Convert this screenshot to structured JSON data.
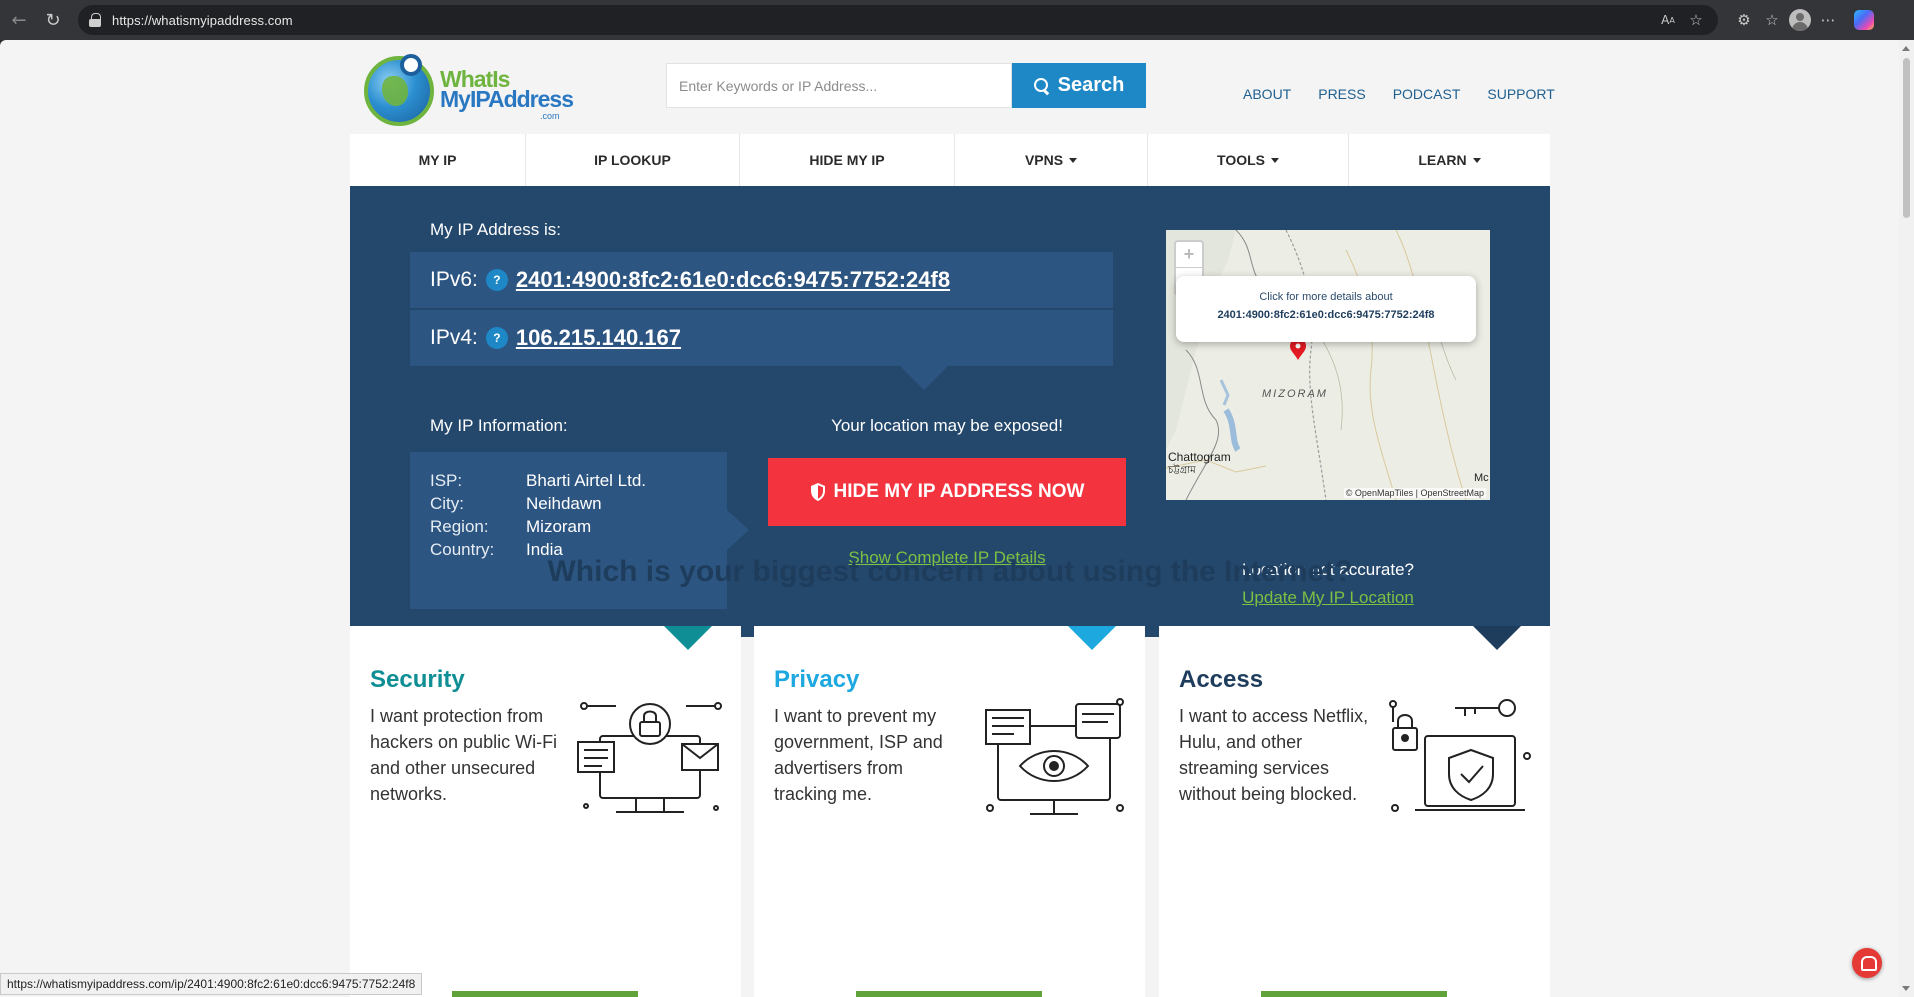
{
  "browser": {
    "url": "https://whatismyipaddress.com",
    "status_url": "https://whatismyipaddress.com/ip/2401:4900:8fc2:61e0:dcc6:9475:7752:24f8"
  },
  "logo": {
    "line1": "WhatIs",
    "line2": "MyIPAddress",
    "line3": ".com"
  },
  "search": {
    "placeholder": "Enter Keywords or IP Address...",
    "button": "Search"
  },
  "toplinks": [
    "ABOUT",
    "PRESS",
    "PODCAST",
    "SUPPORT"
  ],
  "nav": [
    {
      "label": "MY IP",
      "dropdown": false
    },
    {
      "label": "IP LOOKUP",
      "dropdown": false
    },
    {
      "label": "HIDE MY IP",
      "dropdown": false
    },
    {
      "label": "VPNS",
      "dropdown": true
    },
    {
      "label": "TOOLS",
      "dropdown": true
    },
    {
      "label": "LEARN",
      "dropdown": true
    }
  ],
  "ip": {
    "heading": "My IP Address is:",
    "ipv6_label": "IPv6:",
    "ipv6": "2401:4900:8fc2:61e0:dcc6:9475:7752:24f8",
    "ipv4_label": "IPv4:",
    "ipv4": "106.215.140.167",
    "help": "?"
  },
  "info": {
    "heading": "My IP Information:",
    "rows": [
      {
        "key": "ISP:",
        "value": "Bharti Airtel Ltd."
      },
      {
        "key": "City:",
        "value": "Neihdawn"
      },
      {
        "key": "Region:",
        "value": "Mizoram"
      },
      {
        "key": "Country:",
        "value": "India"
      }
    ]
  },
  "exposure": {
    "warning": "Your location may be exposed!",
    "button": "HIDE MY IP ADDRESS NOW",
    "details_link": "Show Complete IP Details"
  },
  "map": {
    "popup_line1": "Click for more details about",
    "popup_line2": "2401:4900:8fc2:61e0:dcc6:9475:7752:24f8",
    "region_label": "MIZORAM",
    "city_label": "Chattogram",
    "city_label_bn": "চট্টগ্রাম",
    "edge_label": "Mc",
    "attribution": "© OpenMapTiles | OpenStreetMap",
    "zoom_in": "+",
    "zoom_out": "−",
    "pin_color": "#e31b23"
  },
  "location": {
    "question": "Location not accurate?",
    "link": "Update My IP Location"
  },
  "concern": {
    "title": "Which is your biggest concern about using the Internet?",
    "cards": [
      {
        "title": "Security",
        "desc": "I want protection from hackers on public Wi-Fi and other unsecured networks.",
        "color": "#0f8f95",
        "icon": "security-illustration-icon"
      },
      {
        "title": "Privacy",
        "desc": "I want to prevent my government, ISP and advertisers from tracking me.",
        "color": "#1ea8e0",
        "icon": "privacy-eye-illustration-icon"
      },
      {
        "title": "Access",
        "desc": "I want to access Netflix, Hulu, and other streaming services without being blocked.",
        "color": "#1e3d5c",
        "icon": "access-lock-illustration-icon"
      }
    ]
  },
  "colors": {
    "hero_bg": "#24476c",
    "hero_panel": "#2d5581",
    "accent_blue": "#1e88c7",
    "cta_red": "#f3343f",
    "link_green": "#7cc142"
  }
}
